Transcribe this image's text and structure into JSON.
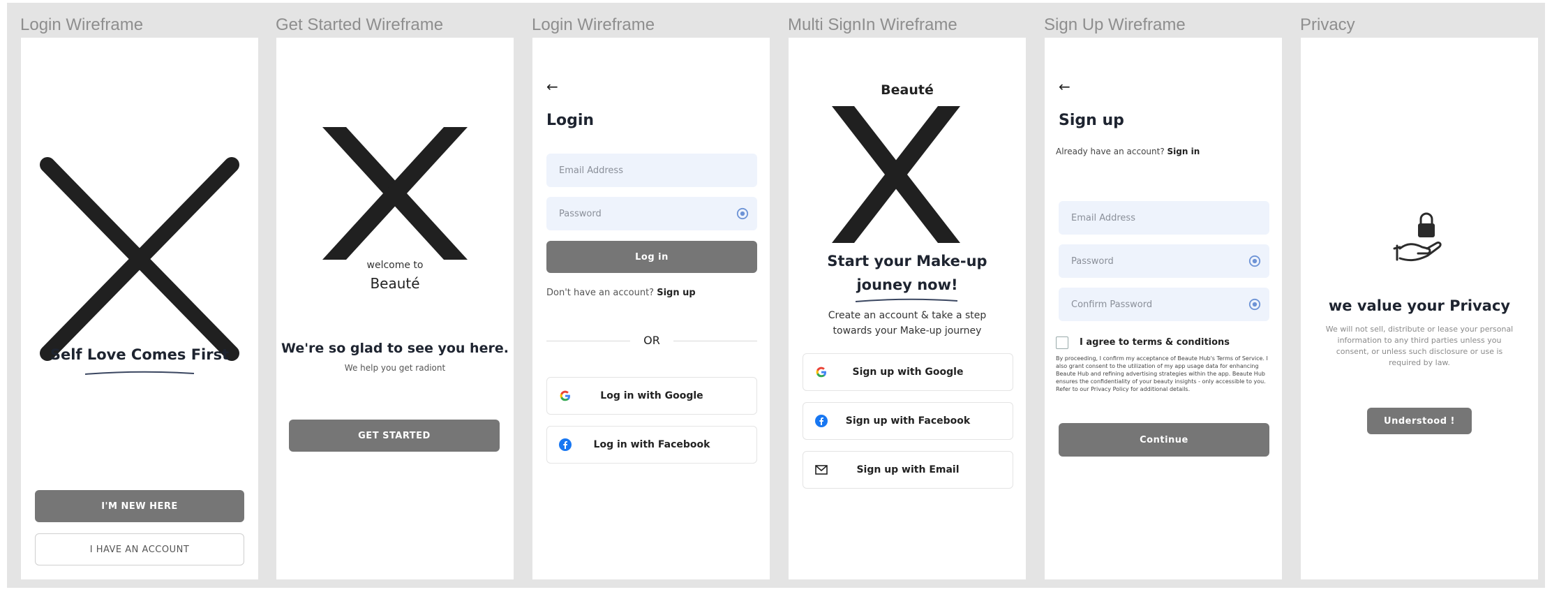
{
  "frames": [
    {
      "title": "Login Wireframe",
      "heading": "Self Love Comes First",
      "primary_button": "I'M NEW HERE",
      "secondary_button": "I HAVE AN ACCOUNT"
    },
    {
      "title": "Get Started Wireframe",
      "welcome": "welcome to",
      "brand": "Beauté",
      "heading": "We're so glad to see you here.",
      "subtext": "We help you get radiont",
      "button": "GET STARTED"
    },
    {
      "title": "Login Wireframe",
      "back": "←",
      "heading": "Login",
      "email_placeholder": "Email Address",
      "password_placeholder": "Password",
      "login_button": "Log in",
      "no_account": "Don't have an account?",
      "signup_link": "Sign up",
      "or": "OR",
      "google": "Log in with Google",
      "facebook": "Log in with Facebook"
    },
    {
      "title": "Multi SignIn Wireframe",
      "brand": "Beauté",
      "heading_line1": "Start your Make-up",
      "heading_line2": "jouney now!",
      "subtext_line1": "Create an account  &  take a step",
      "subtext_line2": "towards your Make-up journey",
      "google": "Sign up with Google",
      "facebook": "Sign up with Facebook",
      "email": "Sign up with Email"
    },
    {
      "title": "Sign Up Wireframe",
      "back": "←",
      "heading": "Sign up",
      "have_account": "Already have an account?",
      "signin_link": "Sign in",
      "email_placeholder": "Email Address",
      "password_placeholder": "Password",
      "confirm_placeholder": "Confirm Password",
      "agree": "I agree to terms & conditions",
      "legal": "By proceeding, I confirm my acceptance of Beaute Hub's Terms of Service. I also grant consent to the utilization of my app usage data for enhancing Beaute Hub and refining advertising strategies within the app. Beaute Hub ensures the confidentiality of your beauty insights - only accessible to you. Refer to our Privacy Policy for additional details.",
      "continue_button": "Continue"
    },
    {
      "title": "Privacy",
      "heading": "we value your Privacy",
      "body": "We will not sell, distribute or lease your personal information to any third parties unless you consent, or unless such disclosure or use is required by law.",
      "button": "Understood !"
    }
  ],
  "colors": {
    "canvas": "#e4e4e4",
    "button_gray": "#767676",
    "field_bg": "#eef3fc",
    "eye_blue": "#6d93d6",
    "google_red": "#ea4335",
    "facebook_blue": "#1877f2"
  },
  "icons": {
    "placeholder": "x-placeholder-icon",
    "back": "back-arrow-icon",
    "eye": "eye-icon",
    "google": "google-icon",
    "facebook": "facebook-icon",
    "email": "email-icon",
    "privacy": "hand-lock-icon"
  }
}
